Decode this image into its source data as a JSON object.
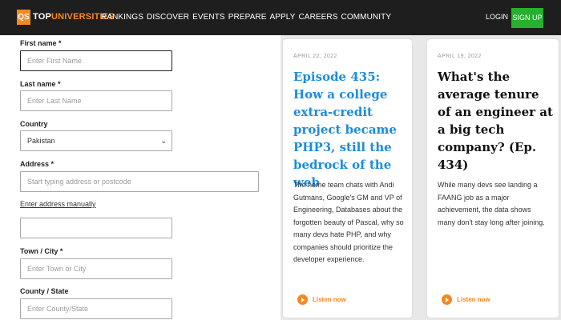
{
  "header": {
    "logo_badge": "QS",
    "brand_top": "TOP",
    "brand_rest": "UNIVERSITIES",
    "nav": [
      "RANKINGS",
      "DISCOVER",
      "EVENTS",
      "PREPARE",
      "APPLY",
      "CAREERS",
      "COMMUNITY"
    ],
    "login": "LOGIN",
    "signup": "SIGN UP"
  },
  "form": {
    "first_name_label": "First name *",
    "first_name_placeholder": "Enter First Name",
    "last_name_label": "Last name *",
    "last_name_placeholder": "Enter Last Name",
    "country_label": "Country",
    "country_value": "Pakistan",
    "address_label": "Address *",
    "address_placeholder": "Start typing address or postcode",
    "manual_link": "Enter address manually",
    "address_manual_value": "",
    "town_label": "Town / City *",
    "town_placeholder": "Enter Town or City",
    "county_label": "County / State",
    "county_placeholder": "Enter County/State"
  },
  "cards": [
    {
      "date": "APRIL 22, 2022",
      "title": "Episode 435: How a college extra-credit project became PHP3, still the bedrock of the web",
      "description": "The home team chats with Andi Gutmans, Google's GM and VP of Engineering, Databases about the forgotten beauty of Pascal, why so many devs hate PHP, and why companies should prioritize the developer experience.",
      "listen": "Listen now"
    },
    {
      "date": "APRIL 19, 2022",
      "title": "What's the average tenure of an engineer at a big tech company? (Ep. 434)",
      "description": "While many devs see landing a FAANG job as a major achievement, the data shows many don't stay long after joining.",
      "listen": "Listen now"
    }
  ],
  "colors": {
    "brand_orange": "#f5891f",
    "signup_green": "#25b12e",
    "link_blue": "#1d8cd9",
    "topbar": "#1e1e1e"
  }
}
